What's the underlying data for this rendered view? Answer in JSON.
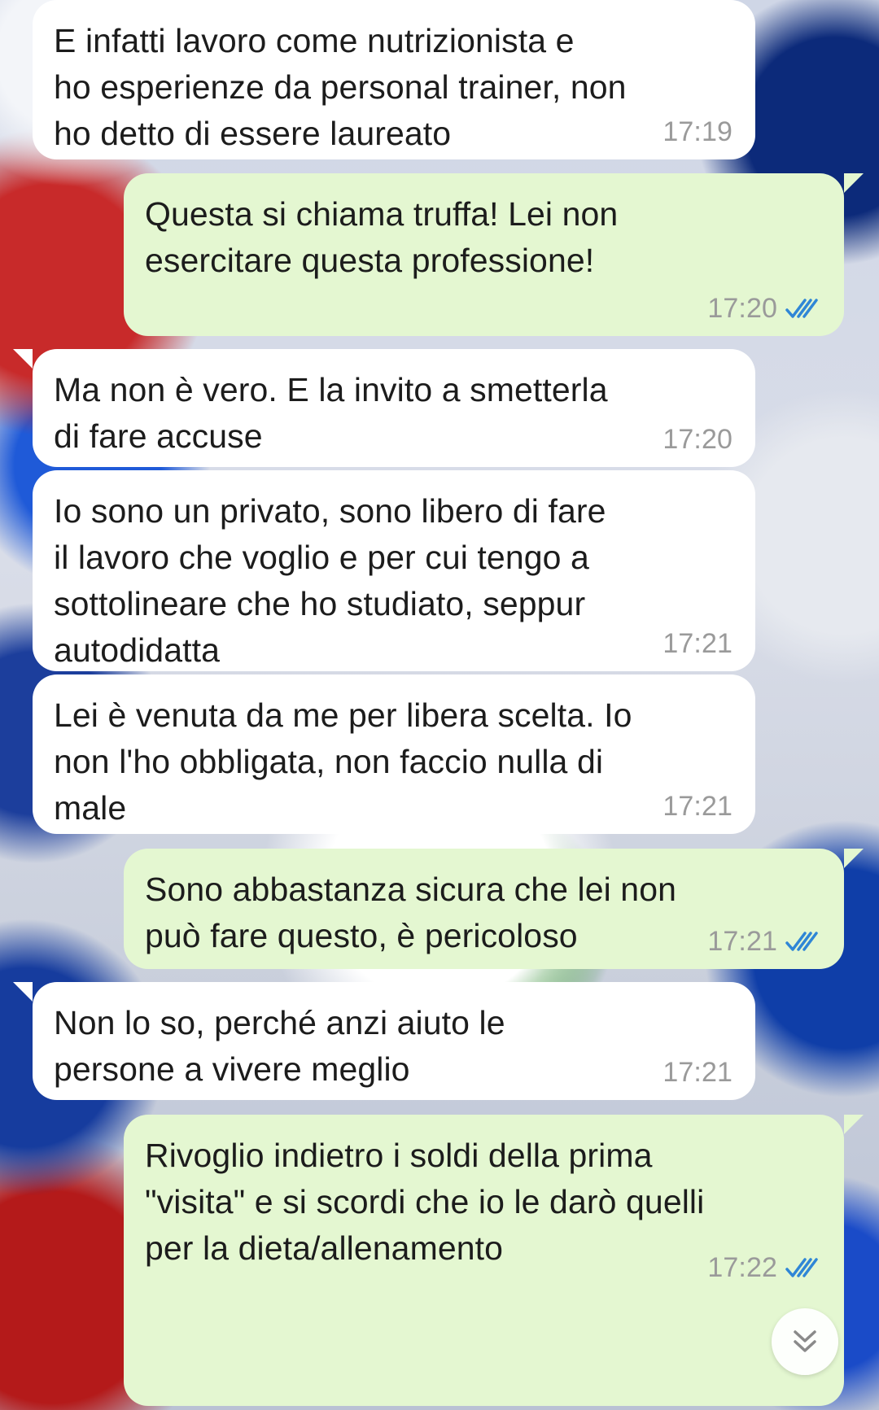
{
  "messages": [
    {
      "direction": "in",
      "text": "E infatti lavoro come nutrizionista e\nho esperienze da personal trainer, non\nho detto di essere laureato",
      "time": "17:19"
    },
    {
      "direction": "out",
      "text": "Questa si chiama truffa! Lei non\nesercitare questa professione!",
      "time": "17:20",
      "status": "read"
    },
    {
      "direction": "in",
      "text": "Ma non è vero. E la invito a smetterla\ndi fare accuse",
      "time": "17:20"
    },
    {
      "direction": "in",
      "text": "Io sono un privato, sono libero di fare\nil lavoro che voglio e per cui tengo a\nsottolineare che ho studiato, seppur\nautodidatta",
      "time": "17:21"
    },
    {
      "direction": "in",
      "text": "Lei è venuta da me per libera scelta. Io\nnon l'ho obbligata, non faccio nulla di\nmale",
      "time": "17:21"
    },
    {
      "direction": "out",
      "text": "Sono abbastanza sicura che lei non\npuò fare questo, è pericoloso",
      "time": "17:21",
      "status": "read"
    },
    {
      "direction": "in",
      "text": "Non lo so, perché anzi aiuto le\npersone a vivere meglio",
      "time": "17:21"
    },
    {
      "direction": "out",
      "text": "Rivoglio indietro i soldi della prima\n\"visita\" e si scordi che io le darò quelli\nper la dieta/allenamento",
      "time": "17:22",
      "status": "read"
    }
  ],
  "colors": {
    "incoming_bubble": "#ffffff",
    "outgoing_bubble": "#e4f7d1",
    "read_ticks": "#2f86d6",
    "timestamp": "#9a9a9a"
  },
  "icons": {
    "read_status": "double-check-icon",
    "scroll_down": "chevron-double-down-icon"
  }
}
